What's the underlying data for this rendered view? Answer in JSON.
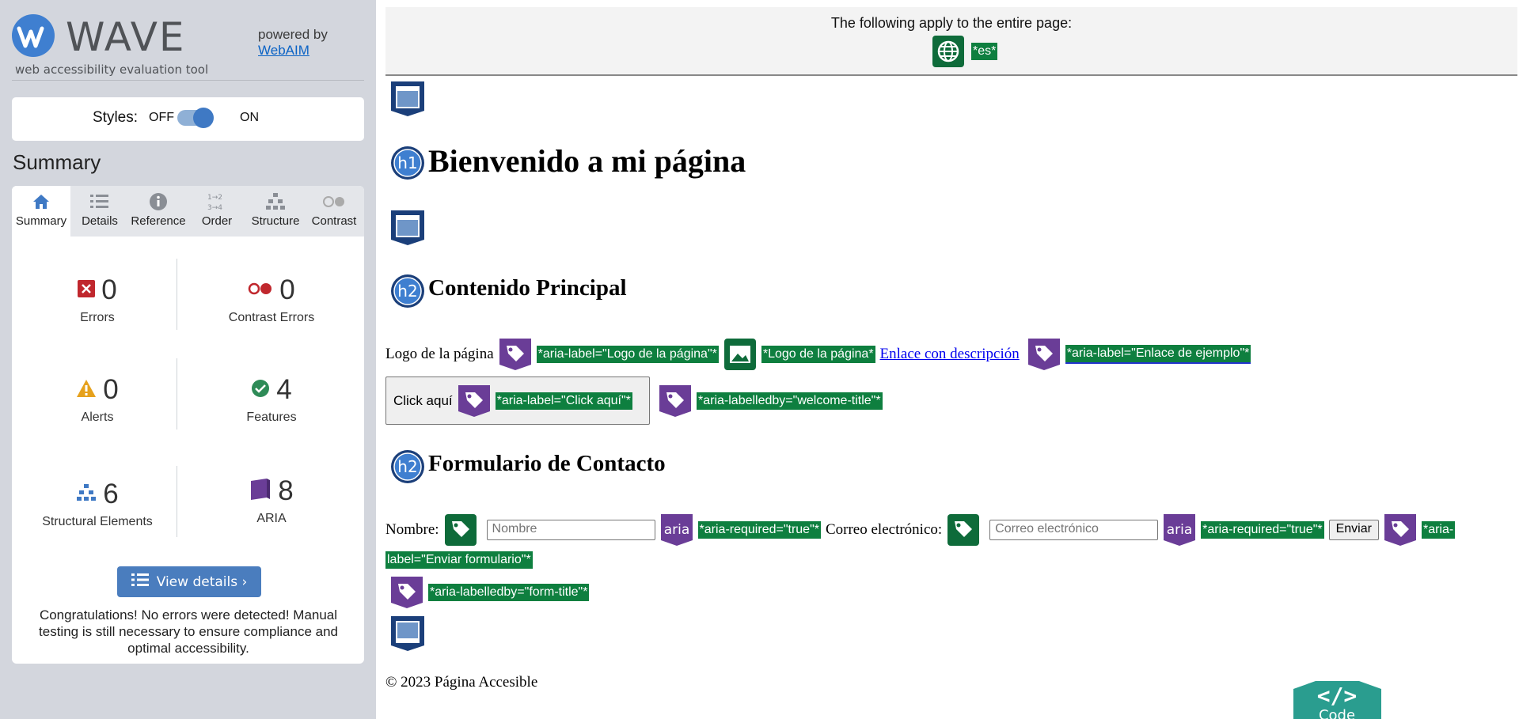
{
  "sidebar": {
    "logo_text": "WAVE",
    "logo_sub": "web accessibility evaluation tool",
    "powered_by": "powered by",
    "powered_link": "WebAIM",
    "styles_label": "Styles:",
    "toggle_off": "OFF",
    "toggle_on": "ON",
    "summary_title": "Summary",
    "tabs": [
      {
        "label": "Summary",
        "icon": "home-icon"
      },
      {
        "label": "Details",
        "icon": "list-icon"
      },
      {
        "label": "Reference",
        "icon": "info-icon"
      },
      {
        "label": "Order",
        "icon": "order-icon"
      },
      {
        "label": "Structure",
        "icon": "structure-icon"
      },
      {
        "label": "Contrast",
        "icon": "contrast-icon"
      }
    ],
    "stats": {
      "errors": {
        "count": "0",
        "label": "Errors"
      },
      "contrast": {
        "count": "0",
        "label": "Contrast Errors"
      },
      "alerts": {
        "count": "0",
        "label": "Alerts"
      },
      "features": {
        "count": "4",
        "label": "Features"
      },
      "structural": {
        "count": "6",
        "label": "Structural Elements"
      },
      "aria": {
        "count": "8",
        "label": "ARIA"
      }
    },
    "view_details": "View details ›",
    "congrats": "Congratulations! No errors were detected! Manual testing is still necessary to ensure compliance and optimal accessibility."
  },
  "page": {
    "banner_text": "The following apply to the entire page:",
    "lang_tag": "*es*",
    "h1_icon": "h1",
    "h1": "Bienvenido a mi página",
    "h2_icon": "h2",
    "h2_main": "Contenido Principal",
    "logo_alt": "Logo de la página",
    "aria_logo": "*aria-label=\"Logo de la página\"*",
    "alt_logo": "*Logo de la página*",
    "link_text": "Enlace con descripción",
    "aria_link": "*aria-label=\"Enlace de ejemplo\"*",
    "click_btn": "Click aquí",
    "aria_click": "*aria-label=\"Click aquí\"*",
    "aria_labelledby_welcome": "*aria-labelledby=\"welcome-title\"*",
    "h2_form": "Formulario de Contacto",
    "nombre_label": "Nombre:",
    "nombre_placeholder": "Nombre",
    "aria_icon_label": "aria",
    "aria_required_1": "*aria-required=\"true\"*",
    "correo_label": "Correo electrónico:",
    "correo_placeholder": "Correo electrónico",
    "aria_required_2": "*aria-required=\"true\"*",
    "enviar_btn": "Enviar",
    "aria_enviar_a": "*aria-",
    "aria_enviar_b": "label=\"Enviar formulario\"*",
    "aria_labelledby_form": "*aria-labelledby=\"form-title\"*",
    "footer": "© 2023 Página Accesible",
    "code_tab": "Code",
    "code_glyph": "</>"
  },
  "colors": {
    "wave_blue": "#3f7fd0",
    "feature_green": "#0e7f3f",
    "aria_purple": "#6a3d97",
    "structure_navy": "#1b3f7a",
    "error_red": "#c0272d",
    "alert_orange": "#e6a11c",
    "code_teal": "#2a9d8f"
  }
}
